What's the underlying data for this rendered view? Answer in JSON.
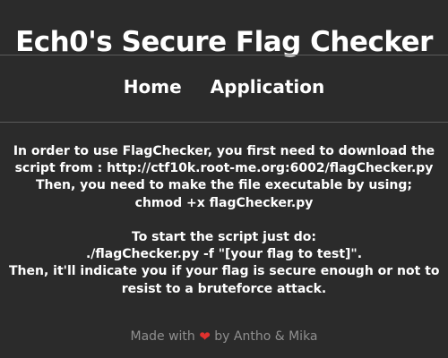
{
  "header": {
    "title": "Ech0's Secure Flag Checker"
  },
  "nav": {
    "items": [
      {
        "label": "Home"
      },
      {
        "label": "Application"
      }
    ]
  },
  "main": {
    "lines": [
      "In order to use FlagChecker, you first need to download the",
      "script from : http://ctf10k.root-me.org:6002/flagChecker.py",
      "Then, you need to make the file executable by using;",
      "chmod +x flagChecker.py",
      "",
      "To start the script just do:",
      "./flagChecker.py -f \"[your flag to test]\".",
      "Then, it'll indicate you if your flag is secure enough or not to",
      "resist to a bruteforce attack."
    ]
  },
  "footer": {
    "made_with": "Made with",
    "heart_icon": "heart-icon",
    "heart": "❤",
    "by": "by Antho & Mika"
  },
  "colors": {
    "background": "#2b2b2b",
    "text": "#ffffff",
    "footer_text": "#8f8f8f",
    "divider": "#5a5a5a",
    "heart": "#e0312e"
  }
}
